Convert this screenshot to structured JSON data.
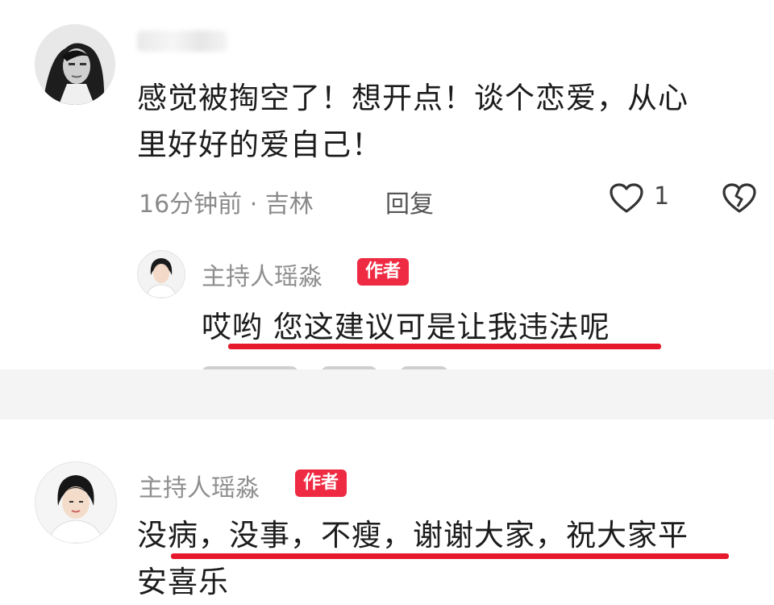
{
  "comment": {
    "text_line1": "感觉被掏空了！想开点！谈个恋爱，从心",
    "text_line2": "里好好的爱自己！",
    "meta": "16分钟前 · 吉林",
    "reply_label": "回复",
    "like_count": "1"
  },
  "reply1": {
    "author": "主持人瑶淼",
    "badge": "作者",
    "text": "哎哟 您这建议可是让我违法呢"
  },
  "reply2": {
    "author": "主持人瑶淼",
    "badge": "作者",
    "text_line1": "没病，没事，不瘦，谢谢大家，祝大家平",
    "text_line2": "安喜乐"
  },
  "colors": {
    "badge": "#ee2b43",
    "underline": "#e5192b",
    "meta_text": "#8a8a8a"
  },
  "icons": {
    "like": "heart-outline-icon",
    "dislike": "broken-heart-icon"
  }
}
